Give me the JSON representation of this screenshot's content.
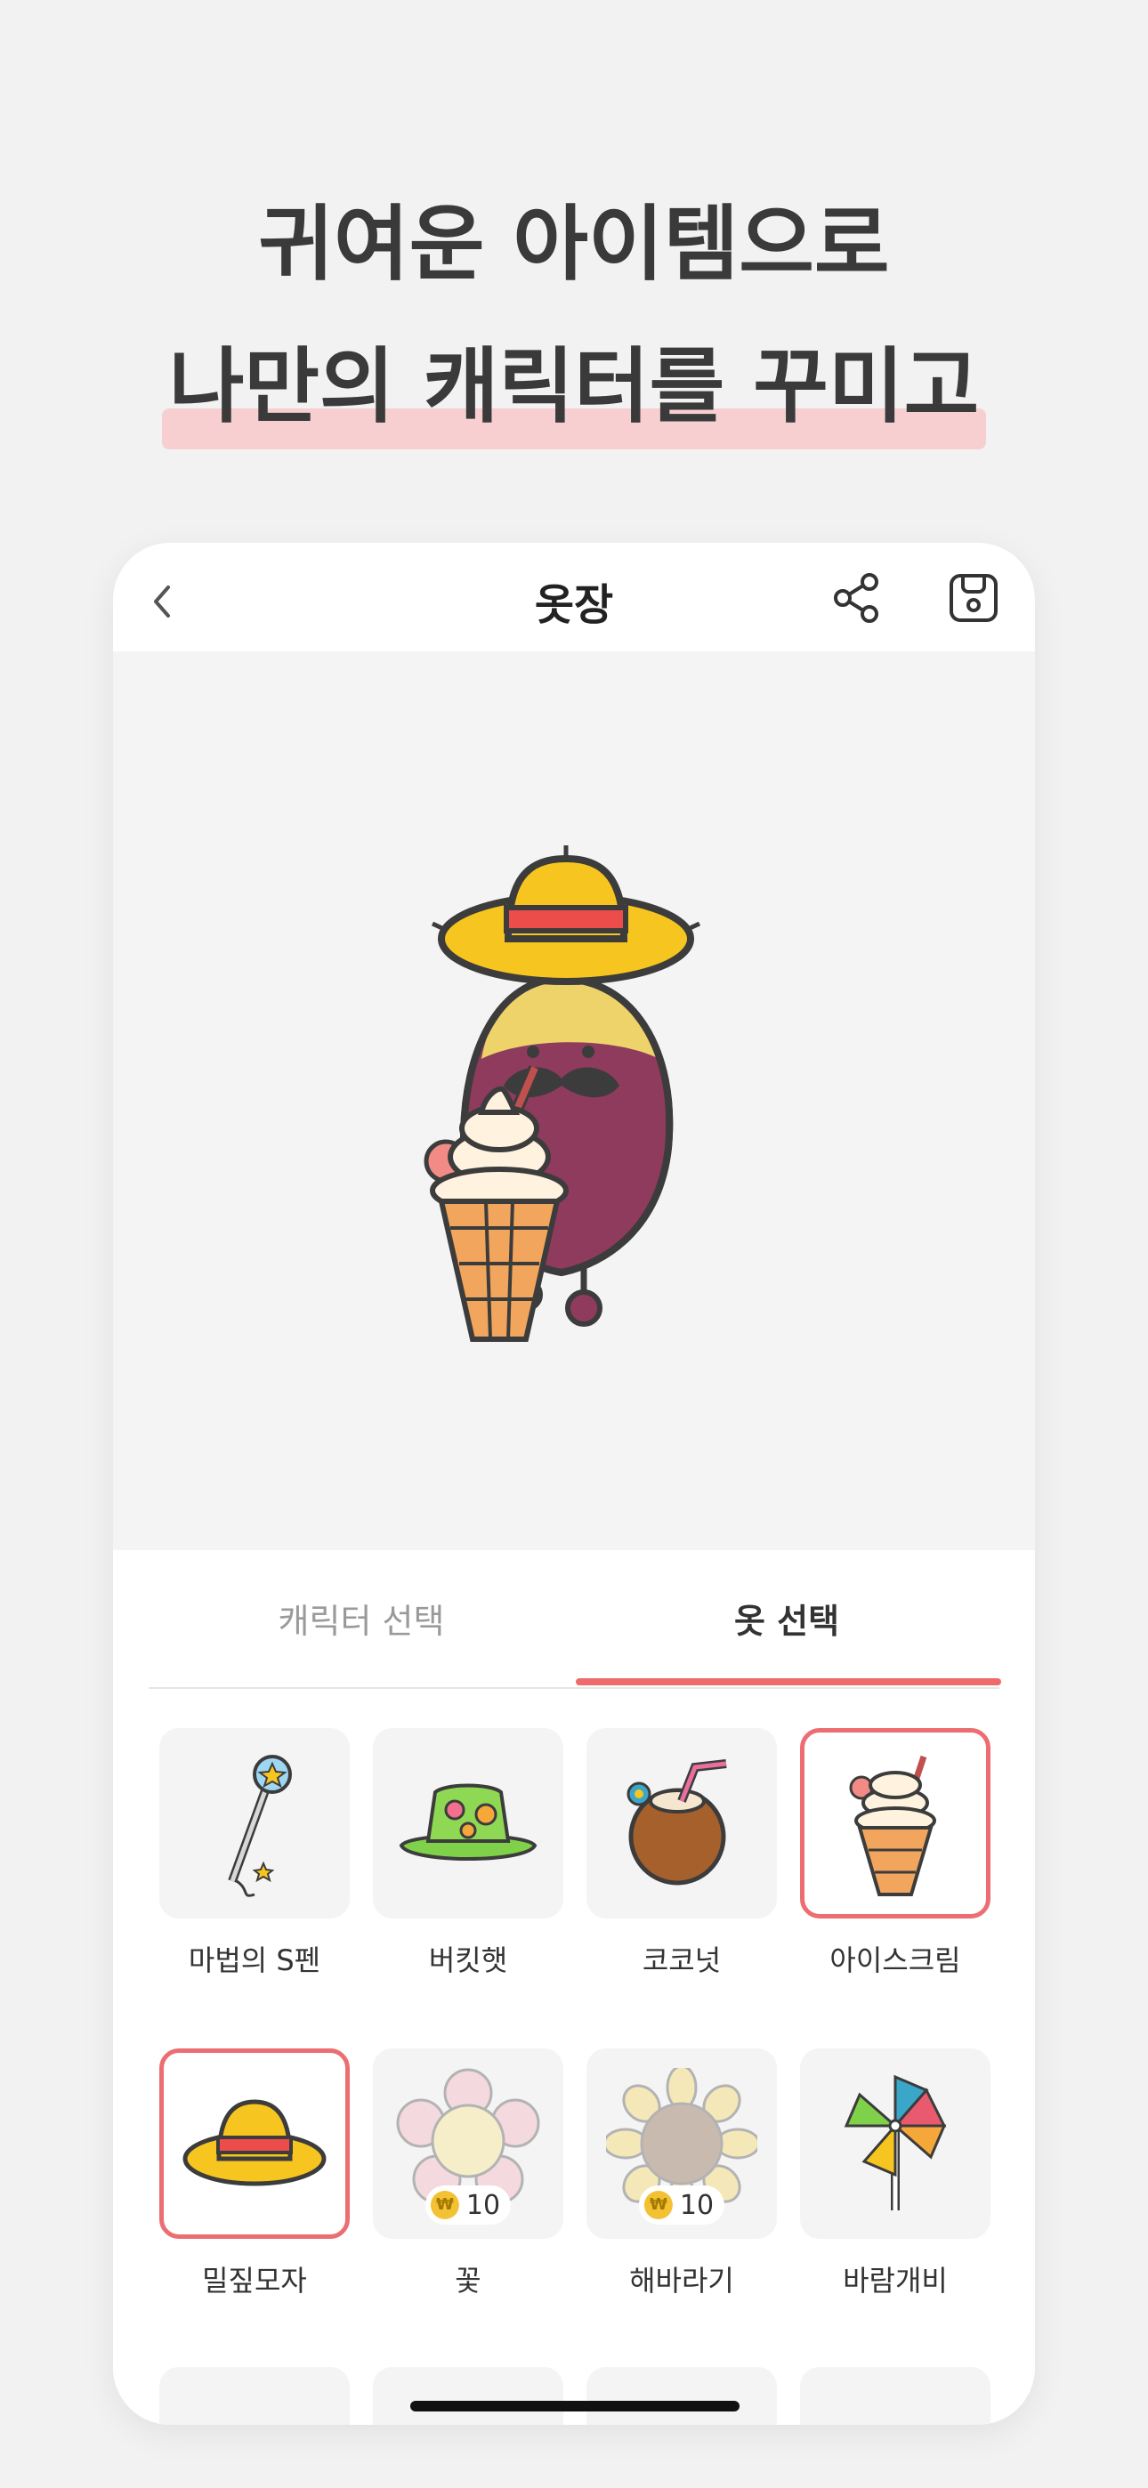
{
  "promo": {
    "line1": "귀여운 아이템으로",
    "line2": "나만의 캐릭터를 꾸미고"
  },
  "navbar": {
    "title": "옷장",
    "back_icon": "chevron-left-icon",
    "share_icon": "share-icon",
    "save_icon": "save-icon"
  },
  "tabs": [
    {
      "label": "캐릭터 선택",
      "active": false
    },
    {
      "label": "옷 선택",
      "active": true
    }
  ],
  "items": [
    {
      "label": "마법의 S펜",
      "icon": "magic-pen-icon",
      "selected": false
    },
    {
      "label": "버킷햇",
      "icon": "bucket-hat-icon",
      "selected": false
    },
    {
      "label": "코코넛",
      "icon": "coconut-icon",
      "selected": false
    },
    {
      "label": "아이스크림",
      "icon": "ice-cream-icon",
      "selected": true
    },
    {
      "label": "밀짚모자",
      "icon": "straw-hat-icon",
      "selected": true
    },
    {
      "label": "꽃",
      "icon": "flower-icon",
      "selected": false,
      "price": "10"
    },
    {
      "label": "해바라기",
      "icon": "sunflower-icon",
      "selected": false,
      "price": "10"
    },
    {
      "label": "바람개비",
      "icon": "pinwheel-icon",
      "selected": false
    }
  ],
  "colors": {
    "accent": "#ef6b6b",
    "highlight": "#f8cfd1",
    "coin": "#f3c234"
  }
}
